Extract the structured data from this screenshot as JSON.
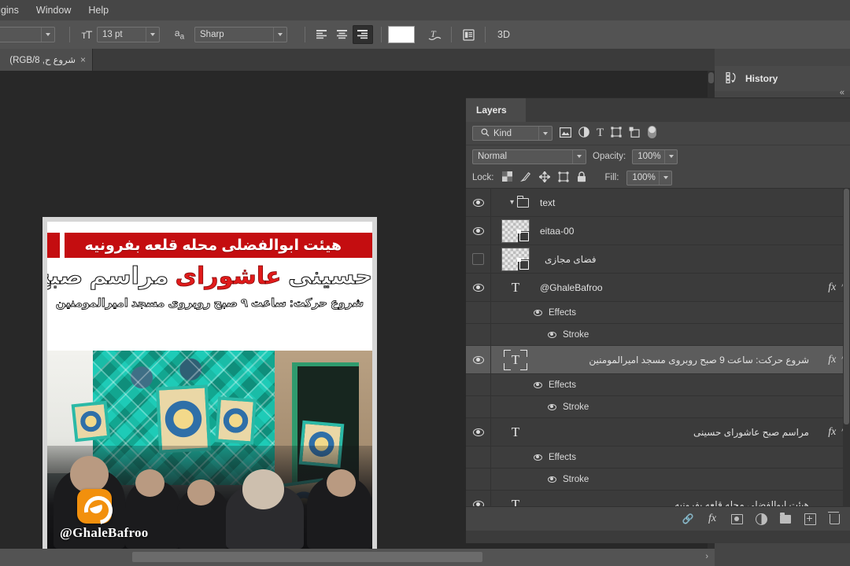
{
  "menubar": {
    "items": [
      {
        "label": "ugins",
        "name": "menu-plugins"
      },
      {
        "label": "Window",
        "name": "menu-window"
      },
      {
        "label": "Help",
        "name": "menu-help"
      }
    ]
  },
  "options_bar": {
    "font_family_value": "",
    "font_size_icon": "font-size-icon",
    "font_size_value": "13 pt",
    "antialias_icon": "anti-alias-icon",
    "antialias_value": "Sharp",
    "align_left_icon": "align-left-icon",
    "align_center_icon": "align-center-icon",
    "align_right_icon": "align-right-icon",
    "color_swatch": "#ffffff",
    "warp_text_icon": "warp-text-icon",
    "character_panel_icon": "character-panel-icon",
    "three_d_label": "3D"
  },
  "document_tab": {
    "label": "شروع ح, RGB/8) *",
    "close_icon": "close-icon"
  },
  "history_panel": {
    "icon": "history-icon",
    "title": "History",
    "collapse_icon": "collapse-arrows-icon"
  },
  "layers_panel": {
    "tab_label": "Layers",
    "menu_icon": "panel-menu-icon",
    "filter": {
      "search_icon": "search-icon",
      "kind_value": "Kind",
      "icons": [
        "pixel-layer-filter-icon",
        "adjustment-layer-filter-icon",
        "type-layer-filter-icon",
        "shape-layer-filter-icon",
        "smart-object-filter-icon",
        "filter-toggle-switch-icon"
      ]
    },
    "blend_mode": "Normal",
    "opacity_label": "Opacity:",
    "opacity_value": "100%",
    "lock_label": "Lock:",
    "lock_icons": [
      "lock-transparent-pixels-icon",
      "lock-image-pixels-icon",
      "lock-position-icon",
      "lock-artboard-icon",
      "lock-all-icon"
    ],
    "fill_label": "Fill:",
    "fill_value": "100%",
    "rows": [
      {
        "name": "group-text",
        "label": "text",
        "type": "group",
        "visible": true,
        "expanded": true,
        "indent": 0,
        "fx": false
      },
      {
        "name": "layer-eitaa-00",
        "label": "eitaa-00",
        "type": "smart-object",
        "visible": true,
        "indent": 1,
        "fx": false
      },
      {
        "name": "layer-fazaye-majazi",
        "label": "فضای مجازی",
        "type": "smart-object",
        "visible": false,
        "indent": 1,
        "fx": false,
        "rtl": true
      },
      {
        "name": "layer-ghalebafroo",
        "label": "@GhaleBafroo",
        "type": "text",
        "visible": true,
        "indent": 1,
        "fx": true
      },
      {
        "name": "effects-ghalebafroo",
        "label": "Effects",
        "type": "effects",
        "visible": true,
        "indent": 2
      },
      {
        "name": "stroke-ghalebafroo",
        "label": "Stroke",
        "type": "effect",
        "visible": true,
        "indent": 3
      },
      {
        "name": "layer-shoroo-harekat",
        "label": "شروع حرکت: ساعت 9 صبح روبروی مسجد امیرالمومنین",
        "type": "text",
        "visible": true,
        "indent": 1,
        "fx": true,
        "selected": true,
        "rtl": true
      },
      {
        "name": "effects-shoroo-harekat",
        "label": "Effects",
        "type": "effects",
        "visible": true,
        "indent": 2
      },
      {
        "name": "stroke-shoroo-harekat",
        "label": "Stroke",
        "type": "effect",
        "visible": true,
        "indent": 3
      },
      {
        "name": "layer-marasem-sobh",
        "label": "مراسم صبح عاشورای حسینی",
        "type": "text",
        "visible": true,
        "indent": 1,
        "fx": true,
        "rtl": true
      },
      {
        "name": "effects-marasem-sobh",
        "label": "Effects",
        "type": "effects",
        "visible": true,
        "indent": 2
      },
      {
        "name": "stroke-marasem-sobh",
        "label": "Stroke",
        "type": "effect",
        "visible": true,
        "indent": 3
      },
      {
        "name": "layer-heyat-abolfazli",
        "label": "هیئت ابوالفضلی محله قلعه بفرونیه",
        "type": "text",
        "visible": true,
        "indent": 1,
        "fx": false,
        "rtl": true
      }
    ],
    "footer_icons": [
      "link-layers-icon",
      "add-layer-style-icon",
      "add-layer-mask-icon",
      "new-adjustment-layer-icon",
      "new-group-icon",
      "new-layer-icon",
      "delete-layer-icon"
    ],
    "footer_fx_label": "fx"
  },
  "poster": {
    "banner_text": "هیئت ابوالفضلی محله قلعه بفرونیه",
    "banner_color": "#c40d10",
    "headline_part1": "مراسم صبح",
    "headline_highlight": "عاشورای",
    "headline_part2": "حسینی",
    "headline_highlight_color": "#e01b1b",
    "subline": "شروع حرکت: ساعت ۹ صبح روبروی مسجد امیرالمومنین",
    "watermark_handle": "@GhaleBafroo",
    "watermark_logo": "eitaa-logo-icon"
  }
}
